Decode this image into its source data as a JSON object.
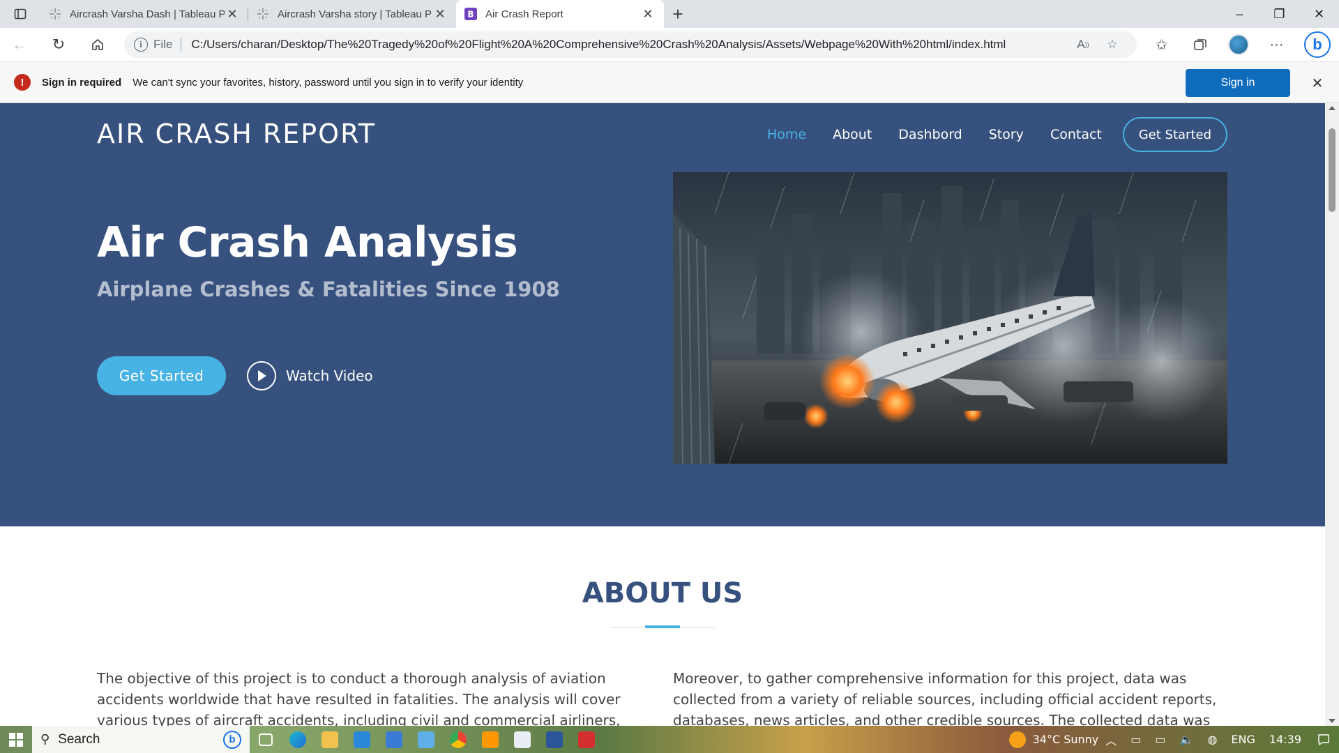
{
  "browser": {
    "tabs": [
      {
        "title": "Aircrash Varsha Dash | Tableau Pu",
        "active": false
      },
      {
        "title": "Aircrash Varsha story | Tableau Pu",
        "active": false
      },
      {
        "title": "Air Crash Report",
        "active": true
      }
    ],
    "address": {
      "scheme_label": "File",
      "url": "C:/Users/charan/Desktop/The%20Tragedy%20of%20Flight%20A%20Comprehensive%20Crash%20Analysis/Assets/Webpage%20With%20html/index.html"
    },
    "infobar": {
      "title": "Sign in required",
      "message": "We can't sync your favorites, history, password until you sign in to verify your identity",
      "button": "Sign in"
    }
  },
  "site": {
    "logo": "AIR CRASH REPORT",
    "nav": [
      {
        "label": "Home",
        "active": true
      },
      {
        "label": "About"
      },
      {
        "label": "Dashbord"
      },
      {
        "label": "Story"
      },
      {
        "label": "Contact"
      }
    ],
    "nav_cta": "Get Started",
    "hero": {
      "title": "Air Crash Analysis",
      "subtitle": "Airplane Crashes & Fatalities Since 1908",
      "primary_button": "Get Started",
      "video_button": "Watch Video"
    },
    "about": {
      "title": "ABOUT US",
      "left": "The objective of this project is to conduct a thorough analysis of aviation accidents worldwide that have resulted in fatalities. The analysis will cover various types of aircraft accidents, including civil and commercial airliners, cargo and military",
      "right": "Moreover, to gather comprehensive information for this project, data was collected from a variety of reliable sources, including official accident reports, databases, news articles, and other credible sources. The collected data was then analyzed using a"
    },
    "colors": {
      "hero_bg": "#37517e",
      "accent": "#47b2e4"
    }
  },
  "taskbar": {
    "search_placeholder": "Search",
    "weather": "34°C  Sunny",
    "language": "ENG",
    "time": "14:39"
  }
}
